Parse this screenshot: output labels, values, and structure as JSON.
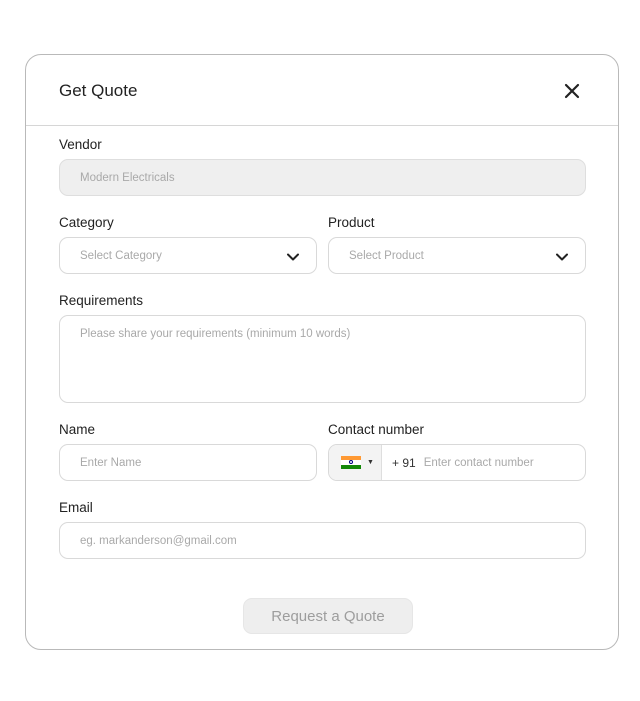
{
  "modal": {
    "title": "Get Quote",
    "submit_label": "Request a Quote"
  },
  "form": {
    "vendor": {
      "label": "Vendor",
      "value": "Modern Electricals"
    },
    "category": {
      "label": "Category",
      "placeholder": "Select Category"
    },
    "product": {
      "label": "Product",
      "placeholder": "Select Product"
    },
    "requirements": {
      "label": "Requirements",
      "placeholder": "Please share your requirements (minimum 10 words)"
    },
    "name": {
      "label": "Name",
      "placeholder": "Enter Name"
    },
    "contact": {
      "label": "Contact number",
      "dial_code": "+ 91",
      "placeholder": "Enter contact number",
      "flag_icon": "india-flag-icon"
    },
    "email": {
      "label": "Email",
      "placeholder": "eg. markanderson@gmail.com"
    }
  },
  "colors": {
    "border": "#d9d9d9",
    "disabled_bg": "#efefef",
    "placeholder": "#a9a9a9",
    "button_bg": "#eeeeee"
  }
}
